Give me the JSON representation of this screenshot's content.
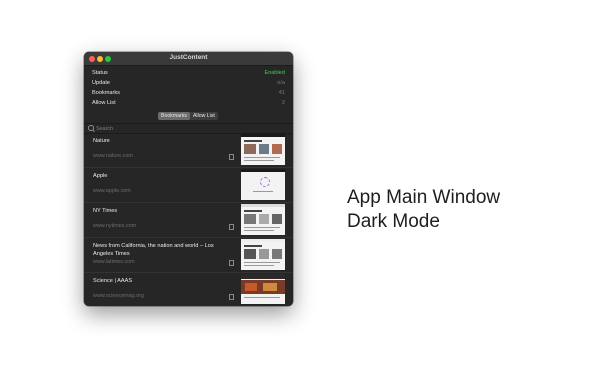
{
  "window": {
    "title": "JustContent"
  },
  "status": [
    {
      "label": "Status",
      "value": "Enabled"
    },
    {
      "label": "Update",
      "value": "n/a"
    },
    {
      "label": "Bookmarks",
      "value": "41"
    },
    {
      "label": "Allow List",
      "value": "2"
    }
  ],
  "segmented": {
    "bookmarks": "Bookmarks",
    "allow_list": "Allow List"
  },
  "search": {
    "placeholder": "Search"
  },
  "items": [
    {
      "title": "Nature",
      "url": "www.nature.com"
    },
    {
      "title": "Apple",
      "url": "www.apple.com"
    },
    {
      "title": "NY Times",
      "url": "www.nytimes.com"
    },
    {
      "title": "News from California, the nation and world – Los Angeles Times",
      "url": "www.latimes.com"
    },
    {
      "title": "Science | AAAS",
      "url": "www.sciencemag.org"
    }
  ],
  "caption": {
    "line1": "App Main Window",
    "line2": "Dark Mode"
  },
  "colors": {
    "enabled": "#38d24b",
    "background": "#262626"
  }
}
